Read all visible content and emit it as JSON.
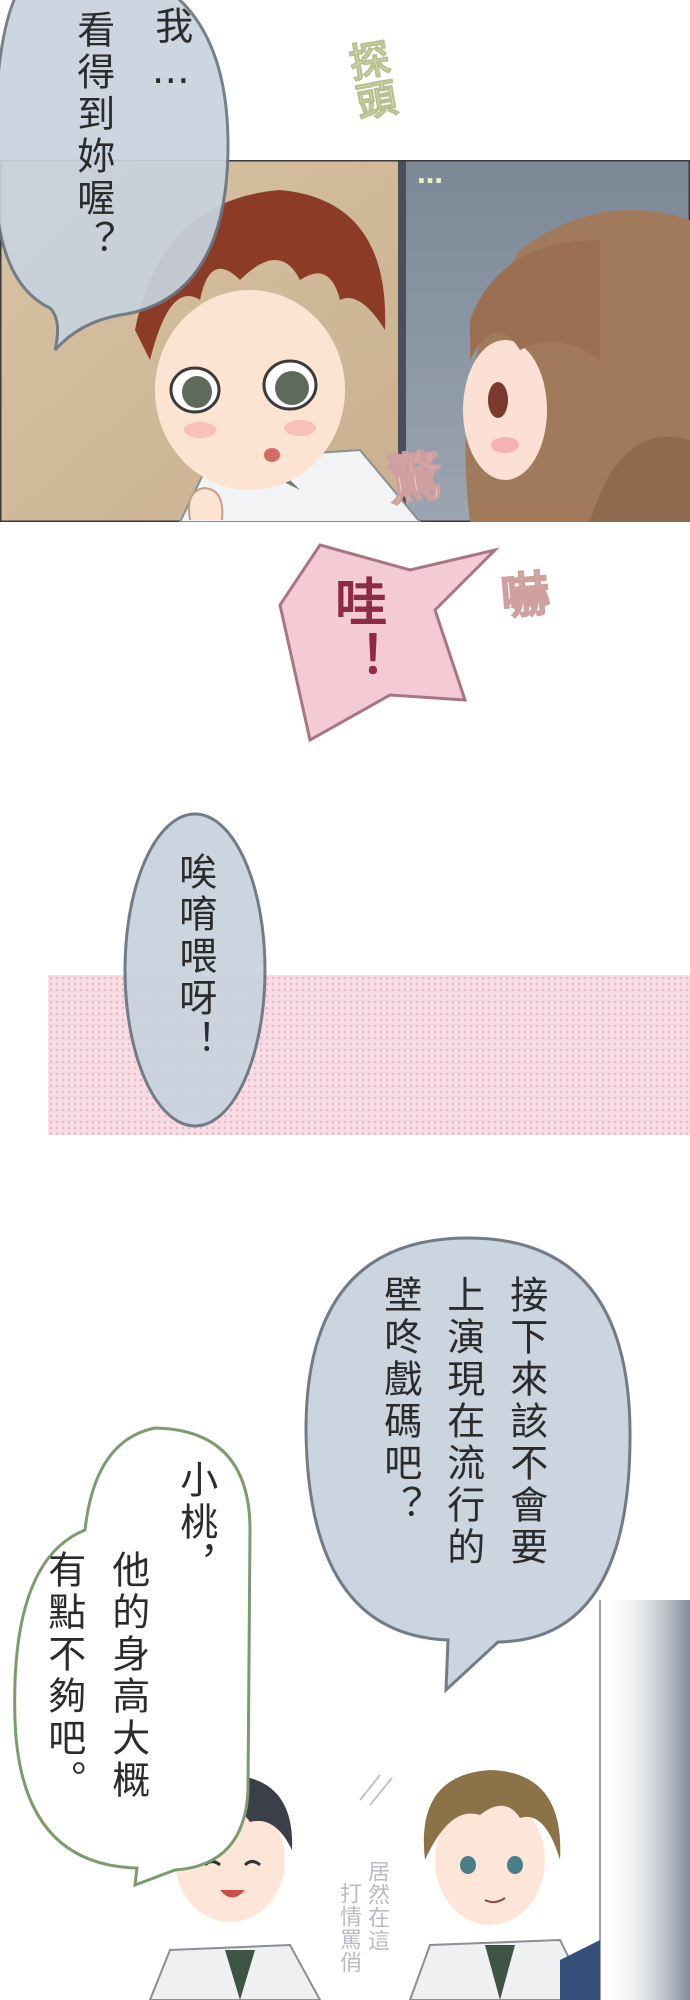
{
  "panel1": {
    "bubble_lines": [
      "我…",
      "看得到妳喔？"
    ],
    "sfx_peek": "探頭",
    "sfx_peek_dots": "…",
    "sfx_shock": "驚",
    "bubble_color": "#c8d3de"
  },
  "shout": {
    "text": "哇！",
    "sfx_scare": "嚇",
    "bubble_color": "#f4cbd5",
    "text_color": "#8d2a46"
  },
  "gap": {
    "text": "唉唷喂呀！",
    "band_color": "#f7dce3"
  },
  "panel3": {
    "right_bubble_lines": [
      "接下來該不會要",
      "上演現在流行的",
      "壁咚戲碼吧？"
    ],
    "left_bubble_lines": [
      "小桃，",
      "他的身高大概",
      "有點不夠吧。"
    ],
    "small_lines": [
      "居然在這",
      "打情罵俏"
    ]
  }
}
